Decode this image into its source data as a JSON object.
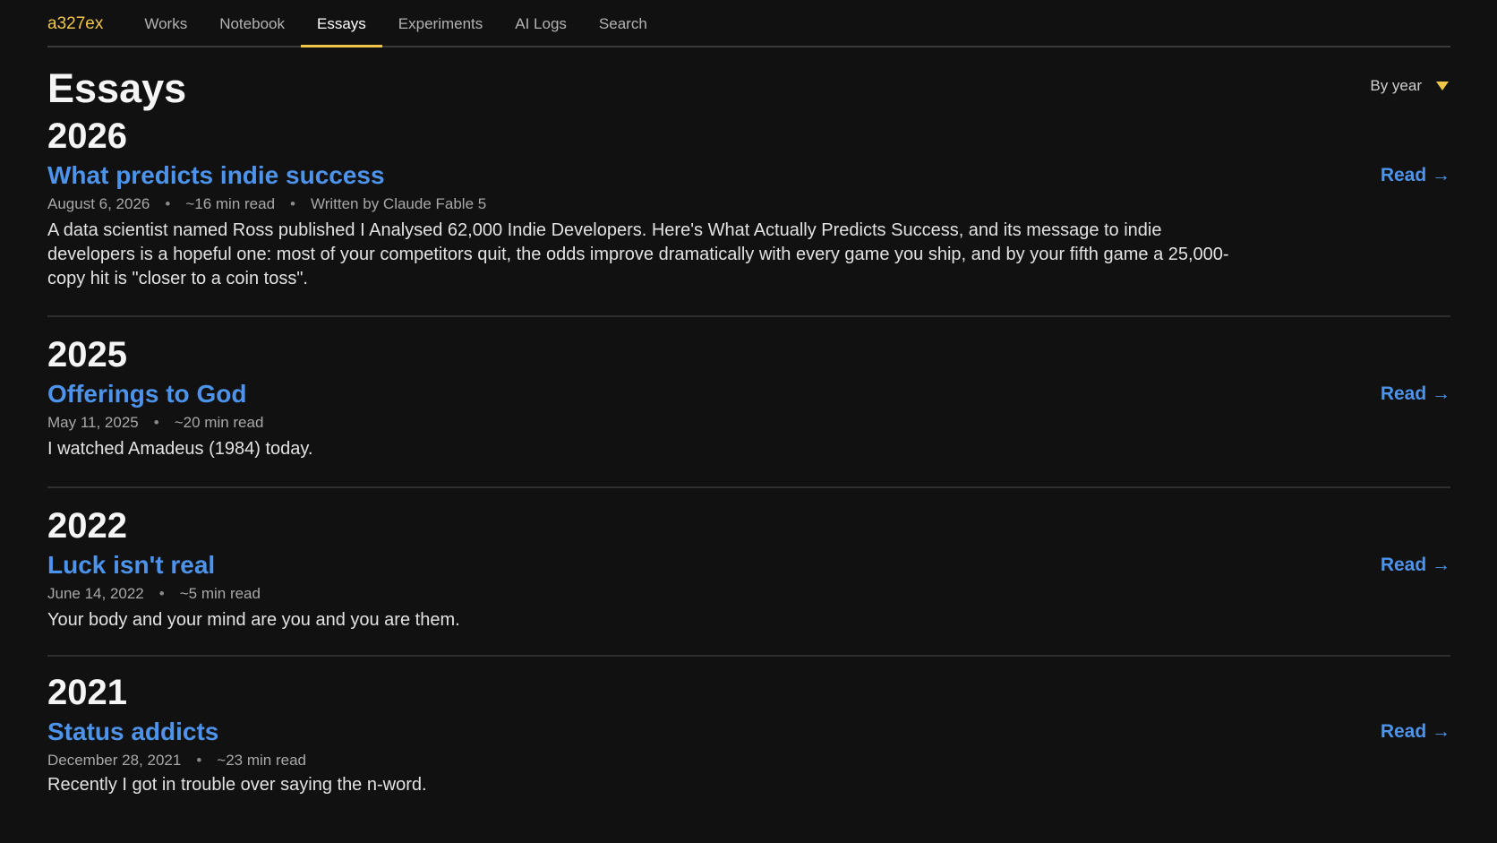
{
  "nav": {
    "brand": "a327ex",
    "items": [
      {
        "label": "Works"
      },
      {
        "label": "Notebook"
      },
      {
        "label": "Essays"
      },
      {
        "label": "Experiments"
      },
      {
        "label": "AI Logs"
      },
      {
        "label": "Search"
      }
    ],
    "active": "Essays"
  },
  "header": {
    "title": "Essays",
    "sort_label": "By year"
  },
  "colors": {
    "accent": "#f0c64a",
    "link": "#4d93ea",
    "background": "#111111"
  },
  "sections": [
    {
      "year": "2026",
      "title": "What predicts indie success",
      "date": "August 6, 2026",
      "read_time": "~16 min read",
      "author": "Written by Claude Fable 5",
      "excerpt": "A data scientist named Ross published I Analysed 62,000 Indie Developers. Here's What Actually Predicts Success, and its message to indie developers is a hopeful one: most of your competitors quit, the odds improve dramatically with every game you ship, and by your fifth game a 25,000-copy hit is \"closer to a coin toss\".",
      "read_label": "Read →"
    },
    {
      "year": "2025",
      "title": "Offerings to God",
      "date": "May 11, 2025",
      "read_time": "~20 min read",
      "excerpt": "I watched Amadeus (1984) today.",
      "read_label": "Read →"
    },
    {
      "year": "2022",
      "title": "Luck isn't real",
      "date": "June 14, 2022",
      "read_time": "~5 min read",
      "excerpt": "Your body and your mind are you and you are them.",
      "read_label": "Read →"
    },
    {
      "year": "2021",
      "title": "Status addicts",
      "date": "December 28, 2021",
      "read_time": "~23 min read",
      "excerpt": "Recently I got in trouble over saying the n-word.",
      "read_label": "Read →"
    }
  ]
}
